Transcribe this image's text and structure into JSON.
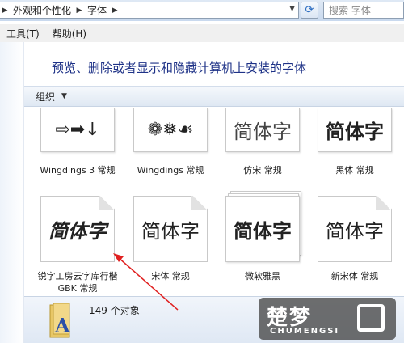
{
  "address": {
    "crumbs": [
      "外观和个性化",
      "字体"
    ],
    "search_placeholder": "搜索 字体"
  },
  "menu": [
    "工具(T)",
    "帮助(H)"
  ],
  "header": {
    "title": "预览、删除或者显示和隐藏计算机上安装的字体"
  },
  "toolbar": {
    "organize_label": "组织"
  },
  "fonts": [
    {
      "name": "Wingdings 3 常规",
      "sample": "⇨➡↓"
    },
    {
      "name": "Wingdings 常规",
      "sample": "❁❅☙"
    },
    {
      "name": "仿宋 常规",
      "sample": "简体字"
    },
    {
      "name": "黑体 常规",
      "sample": "简体字"
    },
    {
      "name": "锐字工房云字库行楷GBK 常规",
      "sample": "简体字"
    },
    {
      "name": "宋体 常规",
      "sample": "简体字"
    },
    {
      "name": "微软雅黑",
      "sample": "简体字"
    },
    {
      "name": "新宋体 常规",
      "sample": "简体字"
    }
  ],
  "status": {
    "count_text": "149 个对象"
  },
  "watermark": {
    "main": "楚梦",
    "sub": "CHUMENGSI"
  },
  "colors": {
    "title": "#1e3287",
    "arrow": "#e02020"
  }
}
